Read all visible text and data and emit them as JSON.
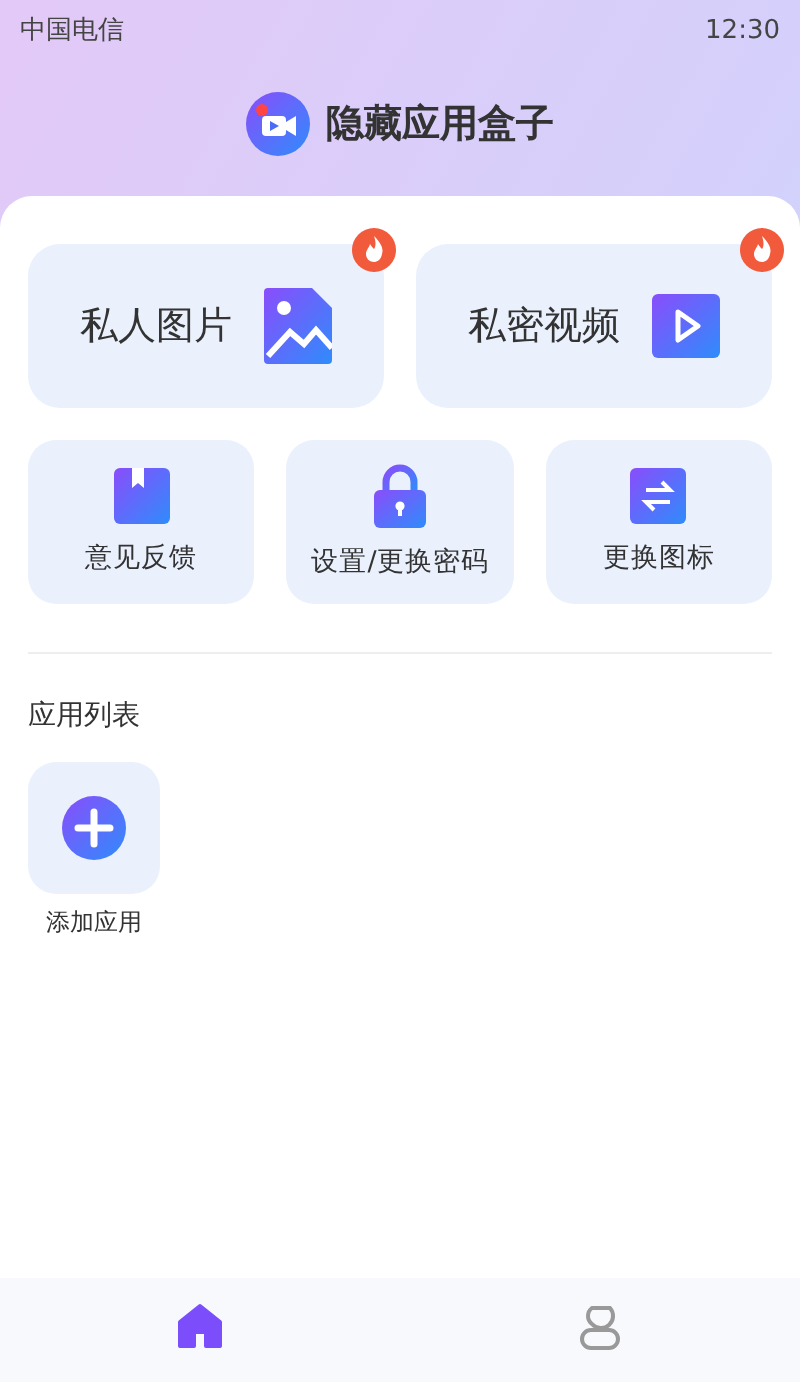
{
  "status_bar": {
    "carrier": "中国电信",
    "time": "12:30"
  },
  "header": {
    "title": "隐藏应用盒子"
  },
  "feature_cards": [
    {
      "label": "私人图片",
      "kind": "image",
      "hot": true
    },
    {
      "label": "私密视频",
      "kind": "video",
      "hot": true
    }
  ],
  "tools": [
    {
      "label": "意见反馈",
      "kind": "bookmark"
    },
    {
      "label": "设置/更换密码",
      "kind": "lock"
    },
    {
      "label": "更换图标",
      "kind": "swap"
    }
  ],
  "app_list": {
    "title": "应用列表",
    "items": [
      {
        "label": "添加应用",
        "kind": "add"
      }
    ]
  },
  "bottom_nav": [
    {
      "kind": "home",
      "selected": true
    },
    {
      "kind": "person",
      "selected": false
    }
  ]
}
